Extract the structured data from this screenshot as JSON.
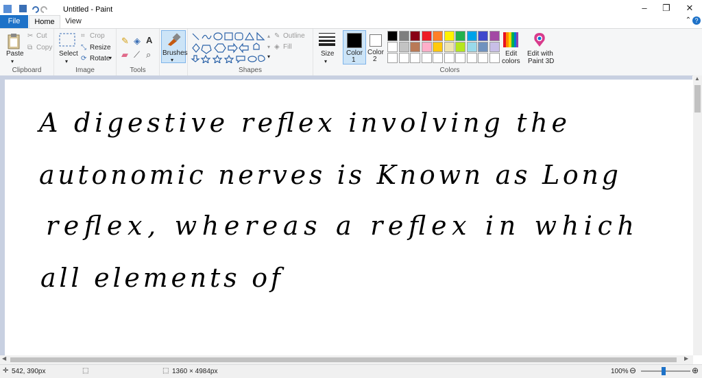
{
  "window": {
    "title": "Untitled - Paint"
  },
  "tabs": {
    "file": "File",
    "home": "Home",
    "view": "View"
  },
  "ribbon": {
    "clipboard": {
      "paste": "Paste",
      "cut": "Cut",
      "copy": "Copy",
      "label": "Clipboard"
    },
    "image": {
      "select": "Select",
      "crop": "Crop",
      "resize": "Resize",
      "rotate": "Rotate",
      "label": "Image"
    },
    "tools": {
      "label": "Tools"
    },
    "brushes": {
      "label": "Brushes"
    },
    "shapes": {
      "outline": "Outline",
      "fill": "Fill",
      "label": "Shapes"
    },
    "size": {
      "label": "Size"
    },
    "color1": {
      "label": "Color",
      "num": "1"
    },
    "color2": {
      "label": "Color",
      "num": "2"
    },
    "colors": {
      "label": "Colors",
      "edit_line1": "Edit",
      "edit_line2": "colors",
      "paint3d_line1": "Edit with",
      "paint3d_line2": "Paint 3D",
      "palette_row1": [
        "#000000",
        "#7f7f7f",
        "#880015",
        "#ed1c24",
        "#ff7f27",
        "#fff200",
        "#22b14c",
        "#00a2e8",
        "#3f48cc",
        "#a349a4"
      ],
      "palette_row2": [
        "#ffffff",
        "#c3c3c3",
        "#b97a57",
        "#ffaec9",
        "#ffc90e",
        "#efe4b0",
        "#b5e61d",
        "#99d9ea",
        "#7092be",
        "#c8bfe7"
      ],
      "primary": "#000000",
      "secondary": "#ffffff"
    }
  },
  "canvas": {
    "handwriting": [
      "A  digestive   reflex   involving   the",
      "autonomic   nerves   is   Known as   Long",
      "reflex,   whereas   a   reflex  in  which",
      "all   elements   of"
    ]
  },
  "status": {
    "cursor_pos": "542, 390px",
    "image_size": "1360 × 4984px",
    "zoom": "100%"
  }
}
